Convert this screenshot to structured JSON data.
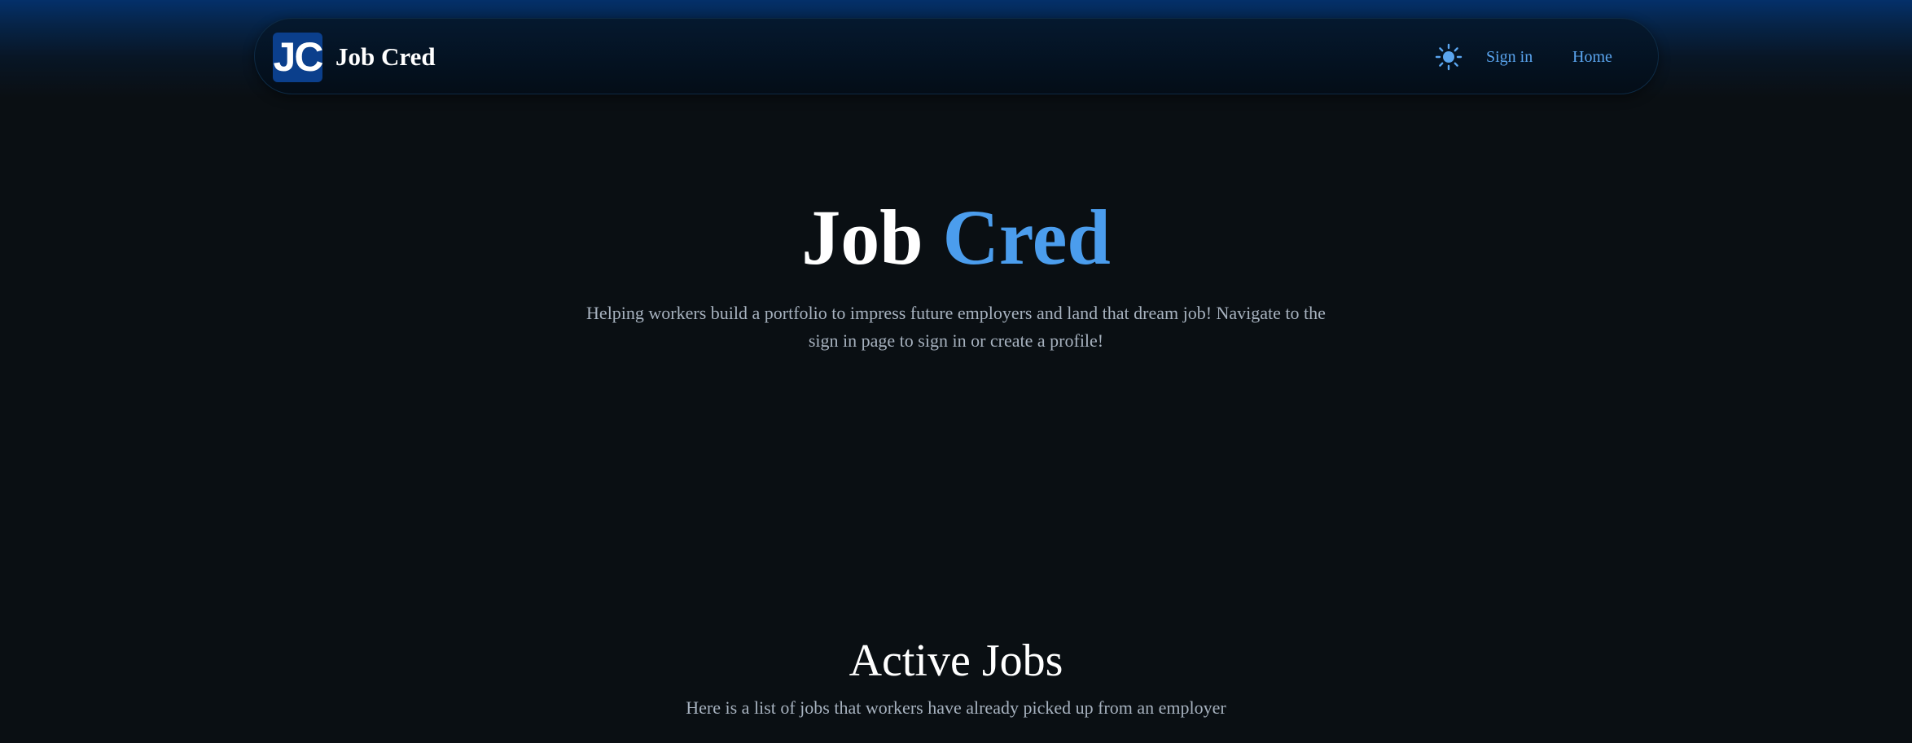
{
  "header": {
    "logo_text": "JC",
    "brand_name": "Job Cred",
    "theme_toggle_icon": "sun-icon",
    "nav_links": [
      {
        "label": "Sign in"
      },
      {
        "label": "Home"
      }
    ]
  },
  "hero": {
    "title_part1": "Job",
    "title_part2": "Cred",
    "description": "Helping workers build a portfolio to impress future employers and land that dream job! Navigate to the sign in page to sign in or create a profile!"
  },
  "active_jobs": {
    "title": "Active Jobs",
    "description": "Here is a list of jobs that workers have already picked up from an employer"
  },
  "colors": {
    "accent": "#4b9ded",
    "link": "#5aa5ef",
    "logo_bg": "#0b3f8c",
    "page_bg": "#0a0f13",
    "muted_text": "#a7b2bf"
  }
}
